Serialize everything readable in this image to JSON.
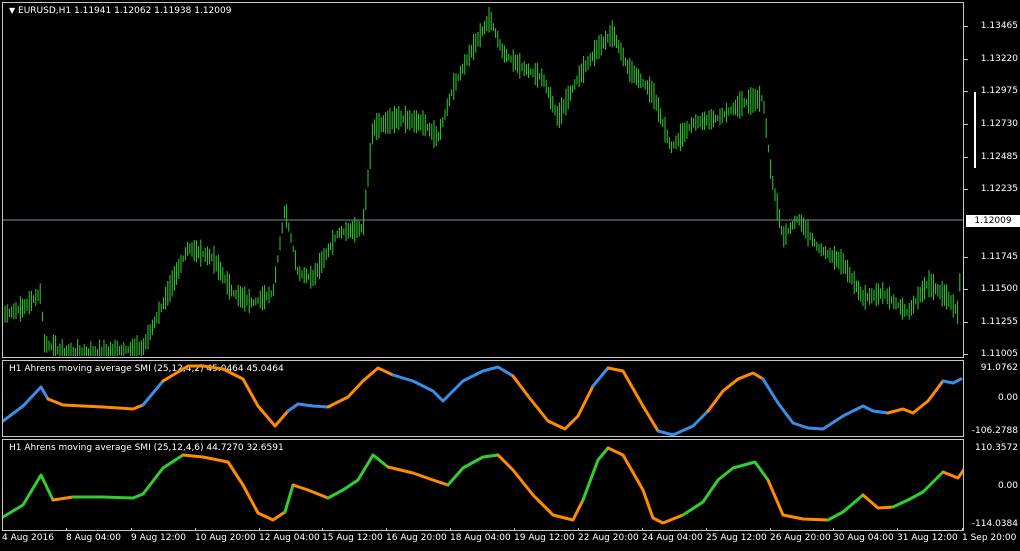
{
  "main_pane": {
    "title": "EURUSD,H1  1.11941 1.12062 1.11938 1.12009",
    "price_ticks": [
      "1.13465",
      "1.13220",
      "1.12975",
      "1.12730",
      "1.12485",
      "1.12235",
      "1.12009",
      "1.11745",
      "1.11500",
      "1.11255",
      "1.11005"
    ],
    "current_price": "1.12009",
    "bar_color": "#32cd32"
  },
  "indicator1": {
    "title": "H1 Ahrens moving average SMI (25,12,4,2) 45.0464 45.0464",
    "ticks": [
      "91.0762",
      "0.00",
      "-106.2788"
    ],
    "colors": {
      "up": "#3a8ee6",
      "down": "#ff8c00"
    }
  },
  "indicator2": {
    "title": "H1 Ahrens moving average SMI (25,12,4,6) 44.7270 32.6591",
    "ticks": [
      "110.3572",
      "0.00",
      "-114.0384"
    ],
    "colors": {
      "up": "#32cd32",
      "down": "#ff8c00"
    }
  },
  "time_axis": [
    "4 Aug 2016",
    "8 Aug 04:00",
    "9 Aug 12:00",
    "10 Aug 20:00",
    "12 Aug 04:00",
    "15 Aug 12:00",
    "16 Aug 20:00",
    "18 Aug 04:00",
    "19 Aug 12:00",
    "22 Aug 20:00",
    "24 Aug 04:00",
    "25 Aug 12:00",
    "26 Aug 20:00",
    "30 Aug 04:00",
    "31 Aug 12:00",
    "1 Sep 20:00"
  ]
}
